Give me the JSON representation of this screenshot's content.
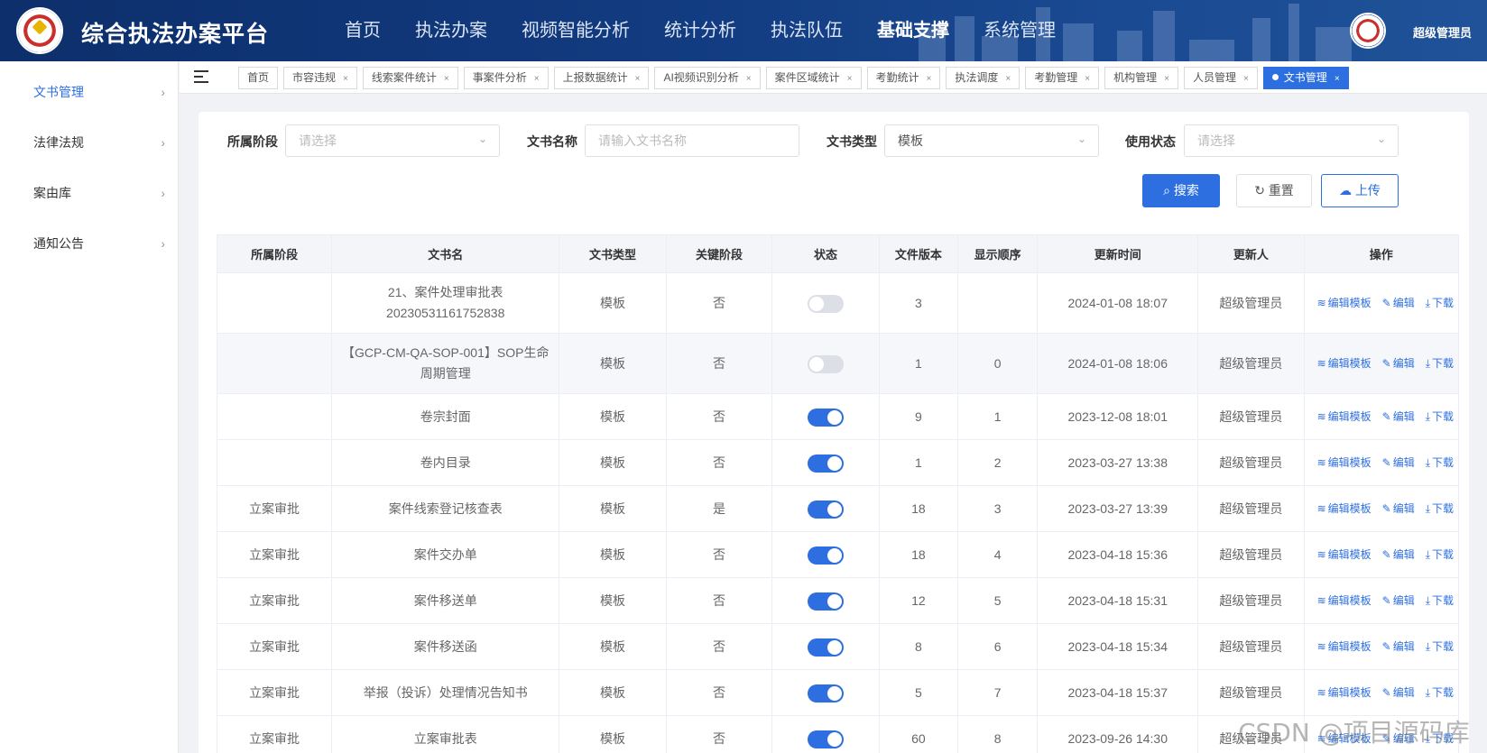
{
  "header": {
    "title": "综合执法办案平台",
    "nav": [
      "首页",
      "执法办案",
      "视频智能分析",
      "统计分析",
      "执法队伍",
      "基础支撑",
      "系统管理"
    ],
    "active_nav": "基础支撑",
    "user": "超级管理员"
  },
  "sidebar": {
    "items": [
      {
        "label": "文书管理",
        "active": true
      },
      {
        "label": "法律法规",
        "active": false
      },
      {
        "label": "案由库",
        "active": false
      },
      {
        "label": "通知公告",
        "active": false
      }
    ]
  },
  "tabs": [
    {
      "label": "首页",
      "closable": false,
      "active": false
    },
    {
      "label": "市容违规",
      "closable": true,
      "active": false
    },
    {
      "label": "线索案件统计",
      "closable": true,
      "active": false
    },
    {
      "label": "事案件分析",
      "closable": true,
      "active": false
    },
    {
      "label": "上报数据统计",
      "closable": true,
      "active": false
    },
    {
      "label": "AI视频识别分析",
      "closable": true,
      "active": false
    },
    {
      "label": "案件区域统计",
      "closable": true,
      "active": false
    },
    {
      "label": "考勤统计",
      "closable": true,
      "active": false
    },
    {
      "label": "执法调度",
      "closable": true,
      "active": false
    },
    {
      "label": "考勤管理",
      "closable": true,
      "active": false
    },
    {
      "label": "机构管理",
      "closable": true,
      "active": false
    },
    {
      "label": "人员管理",
      "closable": true,
      "active": false
    },
    {
      "label": "文书管理",
      "closable": true,
      "active": true
    }
  ],
  "filters": {
    "stage": {
      "label": "所属阶段",
      "placeholder": "请选择",
      "value": ""
    },
    "name": {
      "label": "文书名称",
      "placeholder": "请输入文书名称",
      "value": ""
    },
    "type": {
      "label": "文书类型",
      "placeholder": "",
      "value": "模板"
    },
    "status": {
      "label": "使用状态",
      "placeholder": "请选择",
      "value": ""
    }
  },
  "buttons": {
    "search": "搜索",
    "reset": "重置",
    "upload": "上传"
  },
  "table": {
    "columns": [
      "所属阶段",
      "文书名",
      "文书类型",
      "关键阶段",
      "状态",
      "文件版本",
      "显示顺序",
      "更新时间",
      "更新人",
      "操作"
    ],
    "ops": [
      "编辑模板",
      "编辑",
      "下载"
    ],
    "rows": [
      {
        "stage": "",
        "name": "21、案件处理审批表20230531161752838",
        "type": "模板",
        "key": "否",
        "on": false,
        "version": "3",
        "order": "",
        "time": "2024-01-08 18:07",
        "user": "超级管理员"
      },
      {
        "stage": "",
        "name": "【GCP-CM-QA-SOP-001】SOP生命周期管理",
        "type": "模板",
        "key": "否",
        "on": false,
        "version": "1",
        "order": "0",
        "time": "2024-01-08 18:06",
        "user": "超级管理员"
      },
      {
        "stage": "",
        "name": "卷宗封面",
        "type": "模板",
        "key": "否",
        "on": true,
        "version": "9",
        "order": "1",
        "time": "2023-12-08 18:01",
        "user": "超级管理员"
      },
      {
        "stage": "",
        "name": "卷内目录",
        "type": "模板",
        "key": "否",
        "on": true,
        "version": "1",
        "order": "2",
        "time": "2023-03-27 13:38",
        "user": "超级管理员"
      },
      {
        "stage": "立案审批",
        "name": "案件线索登记核查表",
        "type": "模板",
        "key": "是",
        "on": true,
        "version": "18",
        "order": "3",
        "time": "2023-03-27 13:39",
        "user": "超级管理员"
      },
      {
        "stage": "立案审批",
        "name": "案件交办单",
        "type": "模板",
        "key": "否",
        "on": true,
        "version": "18",
        "order": "4",
        "time": "2023-04-18 15:36",
        "user": "超级管理员"
      },
      {
        "stage": "立案审批",
        "name": "案件移送单",
        "type": "模板",
        "key": "否",
        "on": true,
        "version": "12",
        "order": "5",
        "time": "2023-04-18 15:31",
        "user": "超级管理员"
      },
      {
        "stage": "立案审批",
        "name": "案件移送函",
        "type": "模板",
        "key": "否",
        "on": true,
        "version": "8",
        "order": "6",
        "time": "2023-04-18 15:34",
        "user": "超级管理员"
      },
      {
        "stage": "立案审批",
        "name": "举报（投诉）处理情况告知书",
        "type": "模板",
        "key": "否",
        "on": true,
        "version": "5",
        "order": "7",
        "time": "2023-04-18 15:37",
        "user": "超级管理员"
      },
      {
        "stage": "立案审批",
        "name": "立案审批表",
        "type": "模板",
        "key": "否",
        "on": true,
        "version": "60",
        "order": "8",
        "time": "2023-09-26 14:30",
        "user": "超级管理员"
      }
    ]
  },
  "watermark": "CSDN @项目源码库",
  "colors": {
    "primary": "#2d6fe0",
    "header": "#123b80"
  }
}
